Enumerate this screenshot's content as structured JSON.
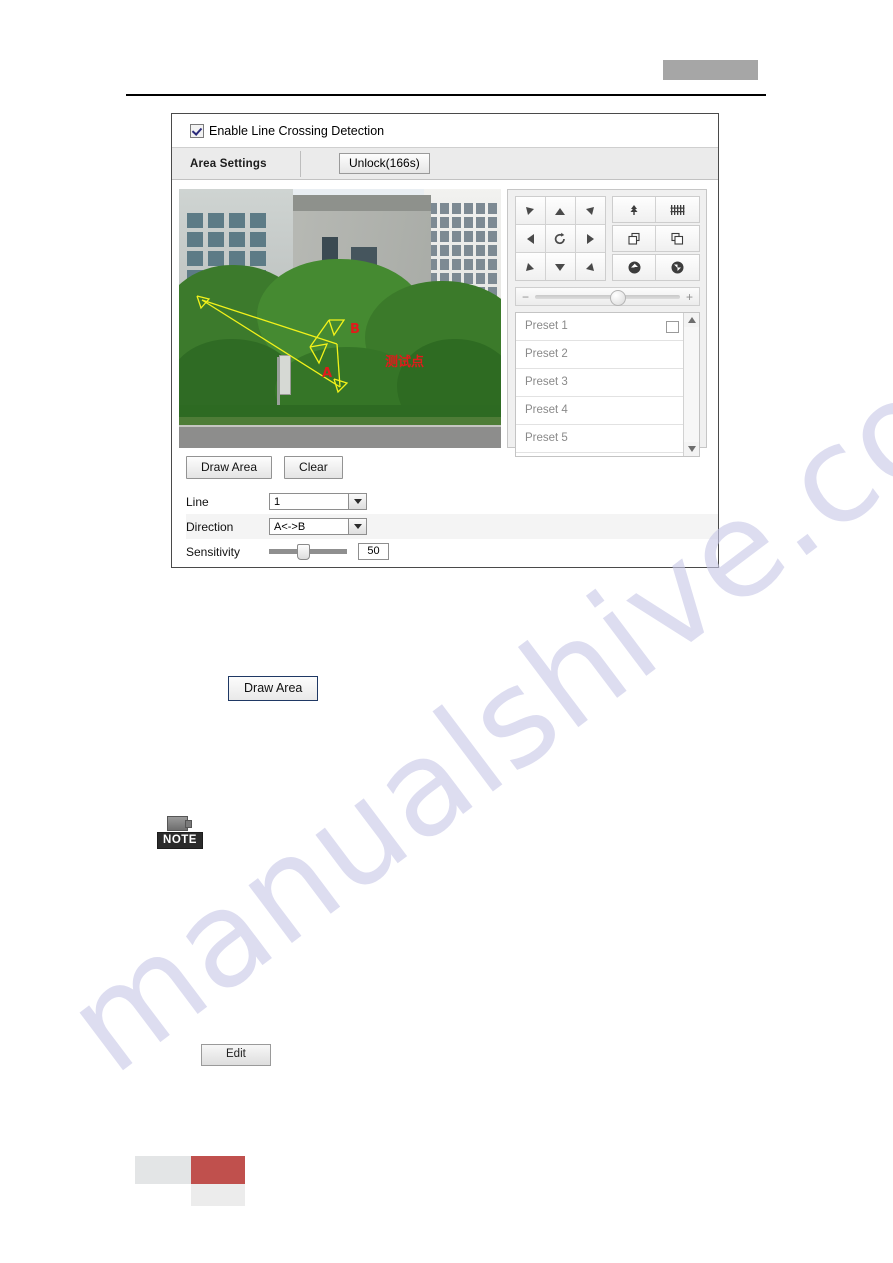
{
  "header": {
    "redaction_color": "#a6a6a6"
  },
  "panel": {
    "enable_checkbox": {
      "label": "Enable Line Crossing Detection",
      "checked": true
    },
    "tab": {
      "title": "Area Settings",
      "unlock_button": "Unlock(166s)"
    },
    "video": {
      "overlay_labels": {
        "point_a": "A",
        "point_b": "B",
        "osd_text": "测试点"
      },
      "line_color": "#f2f21a",
      "label_color": "#e01b1b"
    },
    "ptz": {
      "dpad": [
        {
          "name": "up-left",
          "glyph": "◤"
        },
        {
          "name": "up",
          "glyph": "▲"
        },
        {
          "name": "up-right",
          "glyph": "◥"
        },
        {
          "name": "left",
          "glyph": "◀"
        },
        {
          "name": "auto-scan",
          "glyph": "↻"
        },
        {
          "name": "right",
          "glyph": "▶"
        },
        {
          "name": "down-left",
          "glyph": "◣"
        },
        {
          "name": "down",
          "glyph": "▼"
        },
        {
          "name": "down-right",
          "glyph": "◢"
        }
      ],
      "function_buttons": [
        {
          "name": "zoom-out",
          "glyph": "♣"
        },
        {
          "name": "zoom-in",
          "glyph": "粟"
        },
        {
          "name": "focus-near",
          "glyph": "◰"
        },
        {
          "name": "focus-far",
          "glyph": "◱"
        },
        {
          "name": "iris-minus",
          "glyph": "◉"
        },
        {
          "name": "iris-plus",
          "glyph": "◉"
        }
      ],
      "speed_slider": {
        "minus": "−",
        "plus": "+",
        "value": 52
      },
      "presets": [
        "Preset 1",
        "Preset 2",
        "Preset 3",
        "Preset 4",
        "Preset 5"
      ]
    },
    "controls": {
      "draw_area_button": "Draw Area",
      "clear_button": "Clear",
      "fields": [
        {
          "label": "Line",
          "value": "1"
        },
        {
          "label": "Direction",
          "value": "A<->B"
        }
      ],
      "sensitivity": {
        "label": "Sensitivity",
        "value": "50",
        "slider_percent": 36
      }
    }
  },
  "body": {
    "draw_area_button": "Draw Area",
    "note_icon_label": "NOTE",
    "edit_button": "Edit"
  },
  "watermark": {
    "text": "manualshive.com",
    "color": "#c9c9e8"
  }
}
